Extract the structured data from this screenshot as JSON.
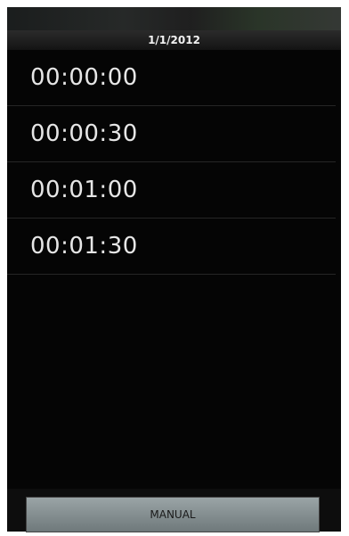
{
  "header": {
    "date": "1/1/2012"
  },
  "list": {
    "items": [
      {
        "time": "00:00:00"
      },
      {
        "time": "00:00:30"
      },
      {
        "time": "00:01:00"
      },
      {
        "time": "00:01:30"
      }
    ]
  },
  "footer": {
    "manual_label": "MANUAL"
  }
}
